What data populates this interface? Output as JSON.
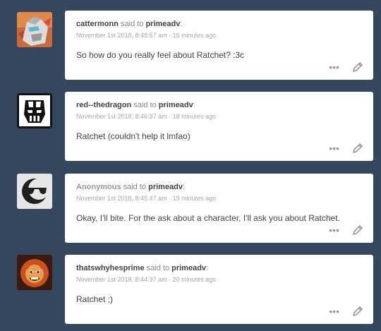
{
  "messages": [
    {
      "username": "cattermonn",
      "said_to": "said to",
      "recipient": "primeadv",
      "timestamp": "November 1st 2018, 8:48:57 am · 16 minutes ago",
      "text": "So how do you really feel about Ratchet? :3c",
      "anonymous": false,
      "avatar_icon": "robot-avatar-icon",
      "more_label": "•••"
    },
    {
      "username": "red--thedragon",
      "said_to": "said to",
      "recipient": "primeadv",
      "timestamp": "November 1st 2018, 8:46:37 am · 18 minutes ago",
      "text": "Ratchet (couldn't help it lmfao)",
      "anonymous": false,
      "avatar_icon": "decepticon-avatar-icon",
      "more_label": "•••"
    },
    {
      "username": "Anonymous",
      "said_to": "said to",
      "recipient": "primeadv",
      "timestamp": "November 1st 2018, 8:45:47 am · 19 minutes ago",
      "text": "Okay, I'll bite. For the ask about a character, I'll ask you about Ratchet.",
      "anonymous": true,
      "avatar_icon": "anonymous-sunglasses-avatar-icon",
      "more_label": "•••"
    },
    {
      "username": "thatswhyhesprime",
      "said_to": "said to",
      "recipient": "primeadv",
      "timestamp": "November 1st 2018, 8:44:37 am · 20 minutes ago",
      "text": "Ratchet ;)",
      "anonymous": false,
      "avatar_icon": "lion-avatar-icon",
      "more_label": "•••"
    }
  ],
  "colors": {
    "background": "#36465d",
    "card": "#ffffff",
    "username": "#444444",
    "anonymous": "#999999",
    "timestamp": "#a7a7a7",
    "icon": "#999999"
  }
}
